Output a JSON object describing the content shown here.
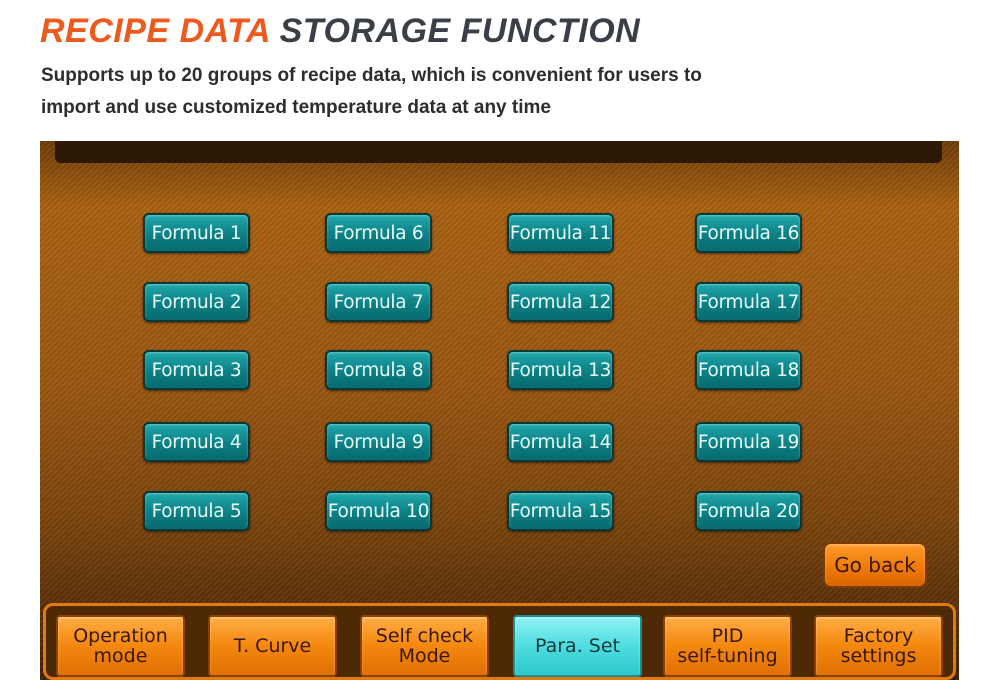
{
  "header": {
    "title_accent": "RECIPE DATA",
    "title_rest": "STORAGE FUNCTION",
    "subtitle_line1": "Supports up to 20 groups of recipe data, which is convenient for users to",
    "subtitle_line2": "import and use customized temperature data at any time"
  },
  "formulas": {
    "f1": "Formula 1",
    "f2": "Formula 2",
    "f3": "Formula 3",
    "f4": "Formula 4",
    "f5": "Formula 5",
    "f6": "Formula 6",
    "f7": "Formula 7",
    "f8": "Formula 8",
    "f9": "Formula 9",
    "f10": "Formula 10",
    "f11": "Formula 11",
    "f12": "Formula 12",
    "f13": "Formula 13",
    "f14": "Formula 14",
    "f15": "Formula 15",
    "f16": "Formula 16",
    "f17": "Formula 17",
    "f18": "Formula 18",
    "f19": "Formula 19",
    "f20": "Formula 20"
  },
  "go_back_label": "Go back",
  "nav": {
    "operation_mode_l1": "Operation",
    "operation_mode_l2": "mode",
    "t_curve": "T. Curve",
    "self_check_l1": "Self check",
    "self_check_l2": "Mode",
    "para_set": "Para. Set",
    "pid_l1": "PID",
    "pid_l2": "self-tuning",
    "factory_l1": "Factory",
    "factory_l2": "settings"
  },
  "colors": {
    "title_accent": "#ee5a1e",
    "title_dark": "#3a3f47",
    "formula_button": "#0d7f83",
    "nav_button": "#f4880f",
    "nav_active": "#4fdde0"
  }
}
